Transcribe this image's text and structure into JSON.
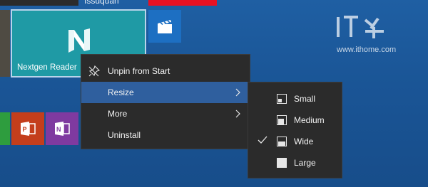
{
  "topbar": {
    "user_label": "Issuquan"
  },
  "tiles": {
    "nextgen": {
      "name": "Nextgen Reader"
    }
  },
  "watermark": {
    "logo_text": "IT之家",
    "url": "www.ithome.com"
  },
  "context_menu": {
    "items": [
      {
        "label": "Unpin from Start",
        "icon": "unpin-icon"
      },
      {
        "label": "Resize",
        "submenu": true,
        "highlighted": true
      },
      {
        "label": "More",
        "submenu": true
      },
      {
        "label": "Uninstall"
      }
    ]
  },
  "resize_submenu": {
    "items": [
      {
        "label": "Small",
        "checked": false
      },
      {
        "label": "Medium",
        "checked": false
      },
      {
        "label": "Wide",
        "checked": true
      },
      {
        "label": "Large",
        "checked": false
      }
    ]
  },
  "colors": {
    "desktop_blue": "#1a5596",
    "menu_bg": "#2b2b2b",
    "menu_highlight": "#2f5f9e",
    "nextgen_tile": "#1f9aa5",
    "powerpoint": "#c43e1c",
    "onenote": "#7f3aa0"
  }
}
